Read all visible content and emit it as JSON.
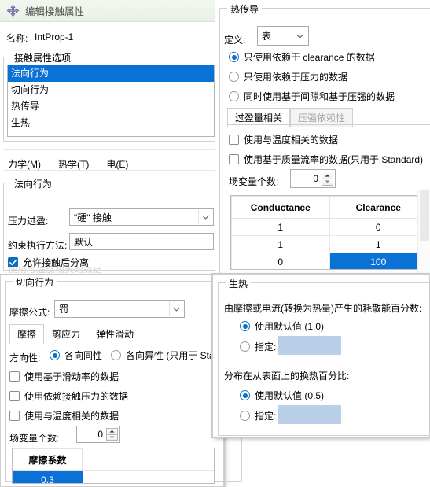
{
  "dialog": {
    "title": "编辑接触属性",
    "title_icon": "move-arrows-icon",
    "name_label": "名称:",
    "name_value": "IntProp-1",
    "options_group": "接触属性选项",
    "options": [
      {
        "label": "法向行为",
        "selected": true
      },
      {
        "label": "切向行为",
        "selected": false
      },
      {
        "label": "热传导",
        "selected": false
      },
      {
        "label": "生热",
        "selected": false
      }
    ],
    "menu": [
      {
        "label": "力学(M)",
        "mnemonic": "M"
      },
      {
        "label": "热学(T)",
        "mnemonic": "T"
      },
      {
        "label": "电(E)",
        "mnemonic": "E"
      }
    ]
  },
  "normal_behavior": {
    "group_title": "法向行为",
    "pressure_overclosure_label": "压力过盈:",
    "pressure_overclosure_value": "\"硬\" 接触",
    "constraint_method_label": "约束执行方法:",
    "constraint_method_value": "默认",
    "allow_separation_label": "允许接触后分离",
    "allow_separation_checked": true
  },
  "tangential_behavior": {
    "group_title": "切向行为",
    "formulation_label": "摩擦公式:",
    "formulation_value": "罚",
    "tabs": [
      {
        "label": "摩擦",
        "active": true
      },
      {
        "label": "剪应力",
        "active": false
      },
      {
        "label": "弹性滑动",
        "active": false
      }
    ],
    "directionality_label": "方向性:",
    "directionality_options": [
      {
        "label": "各向同性",
        "selected": true
      },
      {
        "label": "各向异性 (只用于 Sta",
        "selected": false
      }
    ],
    "checkboxes": [
      {
        "label": "使用基于滑动率的数据",
        "checked": false
      },
      {
        "label": "使用依赖接触压力的数据",
        "checked": false
      },
      {
        "label": "使用与温度相关的数据",
        "checked": false
      }
    ],
    "field_vars_label": "场变量个数:",
    "field_vars_value": "0",
    "table": {
      "columns": [
        "摩擦系数"
      ],
      "rows": [
        [
          "0.3"
        ]
      ],
      "selected_cell": {
        "row": 0,
        "col": 0
      }
    }
  },
  "thermal_conductance": {
    "group_title": "热传导",
    "definition_label": "定义:",
    "definition_value": "表",
    "radios": [
      {
        "label": "只使用依赖于 clearance 的数据",
        "selected": true
      },
      {
        "label": "只使用依赖于压力的数据",
        "selected": false
      },
      {
        "label": "同时使用基于间隙和基于压强的数据",
        "selected": false
      }
    ],
    "tabs": [
      {
        "label": "过盈量相关",
        "active": true,
        "disabled": false
      },
      {
        "label": "压强依赖性",
        "active": false,
        "disabled": true
      }
    ],
    "checkboxes": [
      {
        "label": "使用与温度相关的数据",
        "checked": false
      },
      {
        "label": "使用基于质量流率的数据(只用于 Standard)",
        "checked": false
      }
    ],
    "field_vars_label": "场变量个数:",
    "field_vars_value": "0",
    "table": {
      "columns": [
        "Conductance",
        "Clearance"
      ],
      "rows": [
        [
          "1",
          "0"
        ],
        [
          "1",
          "1"
        ],
        [
          "0",
          "100"
        ]
      ],
      "selected_cell": {
        "row": 2,
        "col": 1
      }
    }
  },
  "heat_generation": {
    "group_title": "生热",
    "fraction_label": "由摩擦或电流(转换为热量)产生的耗散能百分数:",
    "fraction_options": [
      {
        "label": "使用默认值 (1.0)",
        "selected": true
      },
      {
        "label": "指定:",
        "selected": false
      }
    ],
    "fraction_input_value": "",
    "distribution_label": "分布在从表面上的换热百分比:",
    "distribution_options": [
      {
        "label": "使用默认值 (0.5)",
        "selected": true
      },
      {
        "label": "指定:",
        "selected": false
      }
    ],
    "distribution_input_value": ""
  },
  "colors": {
    "selection_blue": "#0a72d6",
    "titlebar_green": "#eef4ea",
    "disabled_input_blue": "#b9d0e8"
  }
}
